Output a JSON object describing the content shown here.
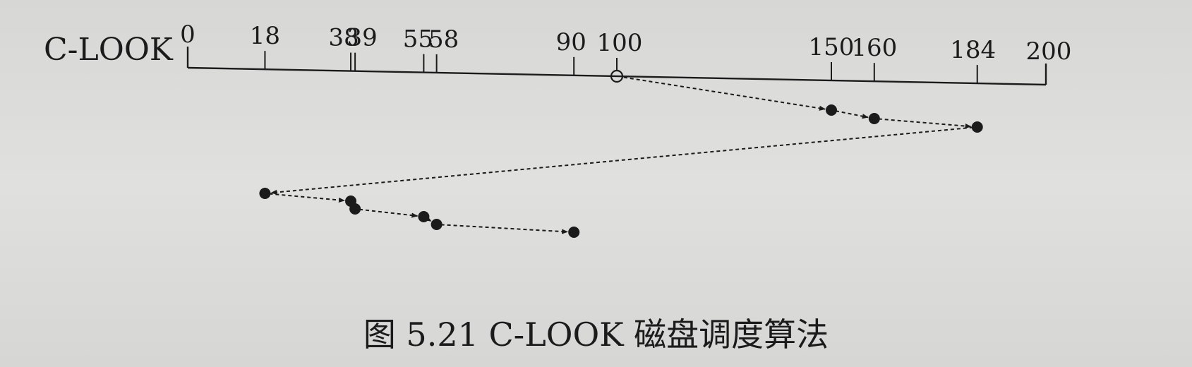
{
  "algorithm_label": "C-LOOK",
  "caption": "图 5.21    C-LOOK 磁盘调度算法",
  "axis": {
    "min": 0,
    "max": 200,
    "ticks": [
      0,
      18,
      38,
      39,
      55,
      58,
      90,
      100,
      150,
      160,
      184,
      200
    ]
  },
  "head_start": 100,
  "sequence": [
    100,
    150,
    160,
    184,
    18,
    38,
    39,
    55,
    58,
    90
  ],
  "colors": {
    "ink": "#1b1b1b",
    "paper": "#dcdcda"
  }
}
